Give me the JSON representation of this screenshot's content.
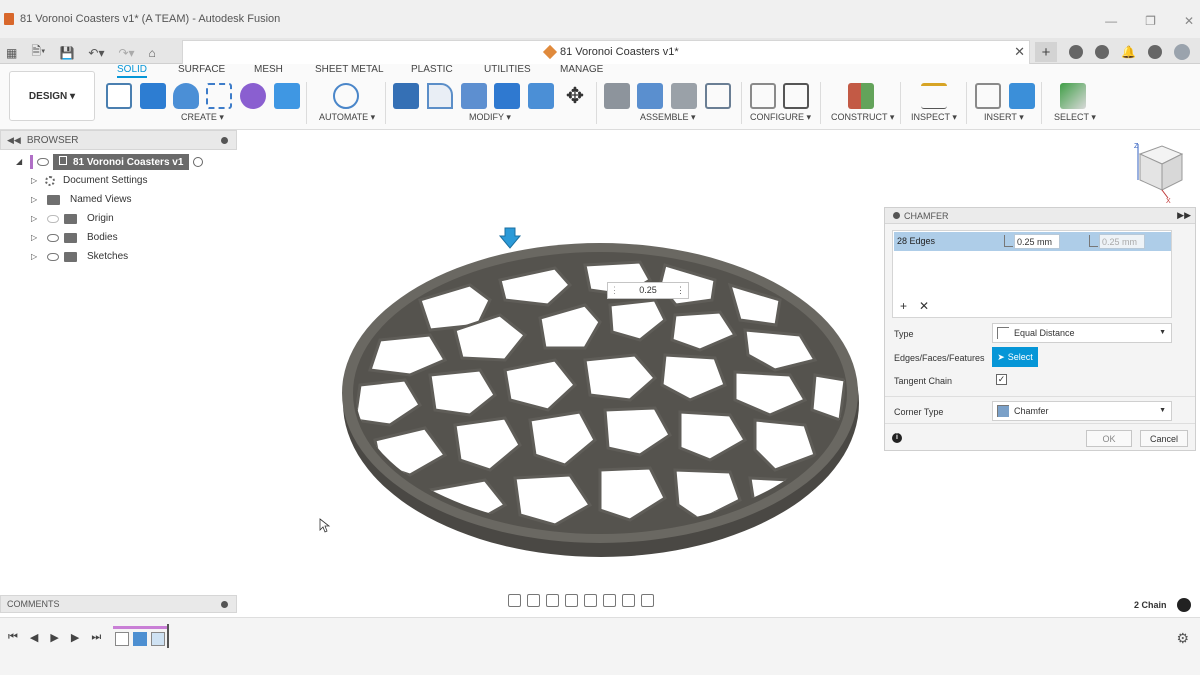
{
  "window": {
    "title": "81 Voronoi Coasters v1* (A TEAM) - Autodesk Fusion"
  },
  "tab": {
    "title": "81 Voronoi Coasters v1*"
  },
  "ribbon": {
    "workspace": "DESIGN",
    "tabs": [
      "SOLID",
      "SURFACE",
      "MESH",
      "SHEET METAL",
      "PLASTIC",
      "UTILITIES",
      "MANAGE"
    ],
    "active_tab": "SOLID",
    "groups": [
      "CREATE",
      "AUTOMATE",
      "MODIFY",
      "ASSEMBLE",
      "CONFIGURE",
      "CONSTRUCT",
      "INSPECT",
      "INSERT",
      "SELECT"
    ]
  },
  "browser": {
    "title": "BROWSER",
    "root": "81 Voronoi Coasters v1",
    "items": [
      "Document Settings",
      "Named Views",
      "Origin",
      "Bodies",
      "Sketches"
    ]
  },
  "chamfer": {
    "title": "CHAMFER",
    "selection": "28 Edges",
    "distance1": "0.25 mm",
    "distance2": "0.25 mm",
    "type_label": "Type",
    "type_value": "Equal Distance",
    "edges_label": "Edges/Faces/Features",
    "select_label": "Select",
    "tangent_label": "Tangent Chain",
    "tangent_checked": true,
    "corner_label": "Corner Type",
    "corner_value": "Chamfer",
    "ok_label": "OK",
    "cancel_label": "Cancel"
  },
  "viewport": {
    "value_input": "0.25"
  },
  "comments": {
    "title": "COMMENTS"
  },
  "status": {
    "chain": "2 Chain"
  },
  "colors": {
    "accent": "#0696d7",
    "body": "#5a5853",
    "selection": "#aecde8"
  }
}
